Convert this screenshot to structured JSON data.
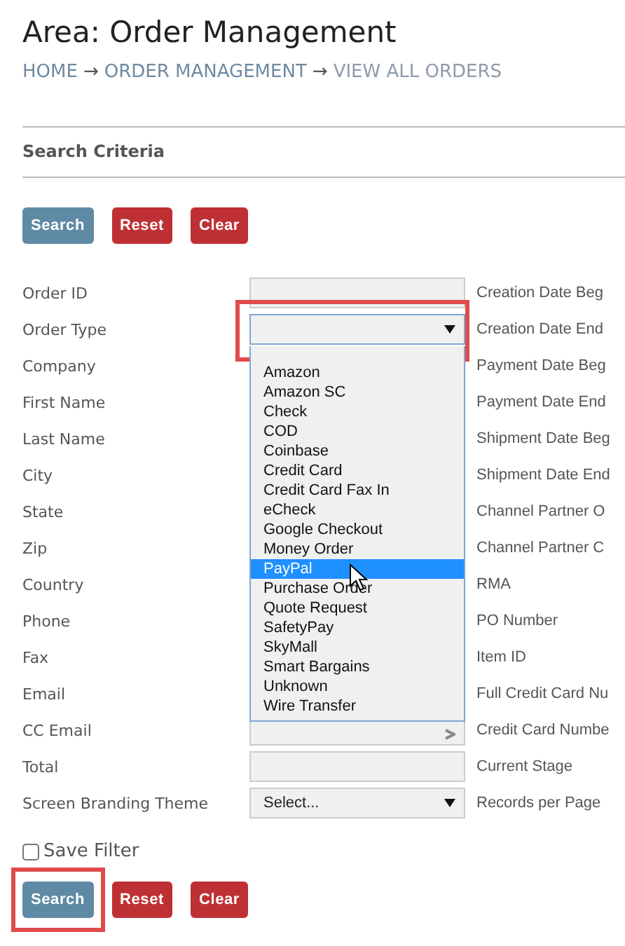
{
  "title": "Area: Order Management",
  "breadcrumb": [
    {
      "label": "HOME",
      "current": false
    },
    {
      "label": "ORDER MANAGEMENT",
      "current": false
    },
    {
      "label": "VIEW ALL ORDERS",
      "current": true
    }
  ],
  "breadcrumb_separator": "→",
  "section_title": "Search Criteria",
  "top_buttons": [
    {
      "label": "Search",
      "kind": "primary",
      "highlighted": false
    },
    {
      "label": "Reset",
      "kind": "danger",
      "highlighted": false
    },
    {
      "label": "Clear",
      "kind": "danger",
      "highlighted": false
    }
  ],
  "rows": [
    {
      "label": "Order ID",
      "field": {
        "kind": "input"
      },
      "right_label": "Creation Date Beg"
    },
    {
      "label": "Order Type",
      "field": {
        "kind": "select",
        "open": true,
        "highlighted": true
      },
      "right_label": "Creation Date End"
    },
    {
      "label": "Company",
      "right_label": "Payment Date Beg"
    },
    {
      "label": "First Name",
      "right_label": "Payment Date End"
    },
    {
      "label": "Last Name",
      "right_label": "Shipment Date Beg"
    },
    {
      "label": "City",
      "right_label": "Shipment Date End"
    },
    {
      "label": "State",
      "right_label": "Channel Partner O"
    },
    {
      "label": "Zip",
      "right_label": "Channel Partner C"
    },
    {
      "label": "Country",
      "right_label": "RMA"
    },
    {
      "label": "Phone",
      "right_label": "PO Number"
    },
    {
      "label": "Fax",
      "right_label": "Item ID"
    },
    {
      "label": "Email",
      "right_label": "Full Credit Card Nu"
    },
    {
      "label": "CC Email",
      "field": {
        "kind": "covered"
      },
      "right_label": "Credit Card Numbe"
    },
    {
      "label": "Total",
      "field": {
        "kind": "input"
      },
      "right_label": "Current Stage"
    },
    {
      "label": "Screen Branding Theme",
      "field": {
        "kind": "select",
        "value": "Select...",
        "open": false,
        "highlighted": false
      },
      "right_label": "Records per Page"
    }
  ],
  "dropdown_options": [
    {
      "label": "Amazon",
      "selected": false
    },
    {
      "label": "Amazon SC",
      "selected": false
    },
    {
      "label": "Check",
      "selected": false
    },
    {
      "label": "COD",
      "selected": false
    },
    {
      "label": "Coinbase",
      "selected": false
    },
    {
      "label": "Credit Card",
      "selected": false
    },
    {
      "label": "Credit Card Fax In",
      "selected": false
    },
    {
      "label": "eCheck",
      "selected": false
    },
    {
      "label": "Google Checkout",
      "selected": false
    },
    {
      "label": "Money Order",
      "selected": false
    },
    {
      "label": "PayPal",
      "selected": true
    },
    {
      "label": "Purchase Order",
      "selected": false
    },
    {
      "label": "Quote Request",
      "selected": false
    },
    {
      "label": "SafetyPay",
      "selected": false
    },
    {
      "label": "SkyMall",
      "selected": false
    },
    {
      "label": "Smart Bargains",
      "selected": false
    },
    {
      "label": "Unknown",
      "selected": false
    },
    {
      "label": "Wire Transfer",
      "selected": false
    }
  ],
  "save_filter": {
    "label": "Save Filter",
    "checked": false
  },
  "bottom_buttons": [
    {
      "label": "Search",
      "kind": "primary",
      "highlighted": true
    },
    {
      "label": "Reset",
      "kind": "danger",
      "highlighted": false
    },
    {
      "label": "Clear",
      "kind": "danger",
      "highlighted": false
    }
  ]
}
